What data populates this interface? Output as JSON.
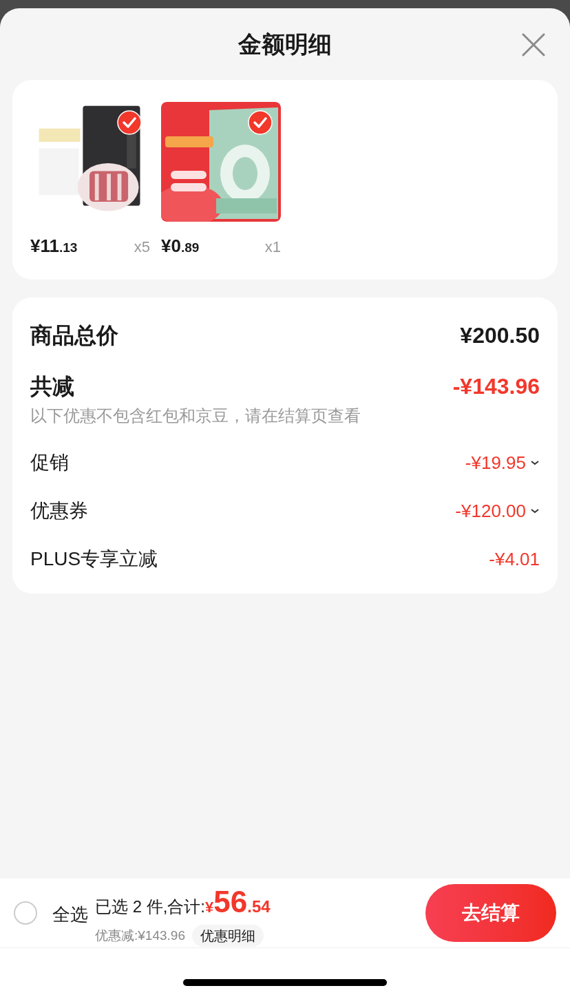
{
  "sheet": {
    "title": "金额明细"
  },
  "products": [
    {
      "kind": "picture",
      "selected": true,
      "price_main": "¥11",
      "price_cents": ".13",
      "quantity": "x5"
    },
    {
      "kind": "picture",
      "selected": true,
      "price_main": "¥0",
      "price_cents": ".89",
      "quantity": "x1"
    }
  ],
  "summary": {
    "total_label": "商品总价",
    "total_value": "¥200.50",
    "discount_label": "共减",
    "discount_value": "-¥143.96",
    "discount_note": "以下优惠不包含红包和京豆，请在结算页查看",
    "items": [
      {
        "label": "促销",
        "value": "-¥19.95",
        "expandable": true
      },
      {
        "label": "优惠券",
        "value": "-¥120.00",
        "expandable": true
      },
      {
        "label": "PLUS专享立减",
        "value": "-¥4.01",
        "expandable": false
      }
    ]
  },
  "footer": {
    "select_all_label": "全选",
    "select_all_checked": false,
    "selected_text": "已选 2 件,合计:",
    "currency": "¥",
    "amount_main": "56",
    "amount_cents": ".54",
    "saving_text": "优惠减:¥143.96",
    "details_button": "优惠明细",
    "checkout_button": "去结算"
  }
}
